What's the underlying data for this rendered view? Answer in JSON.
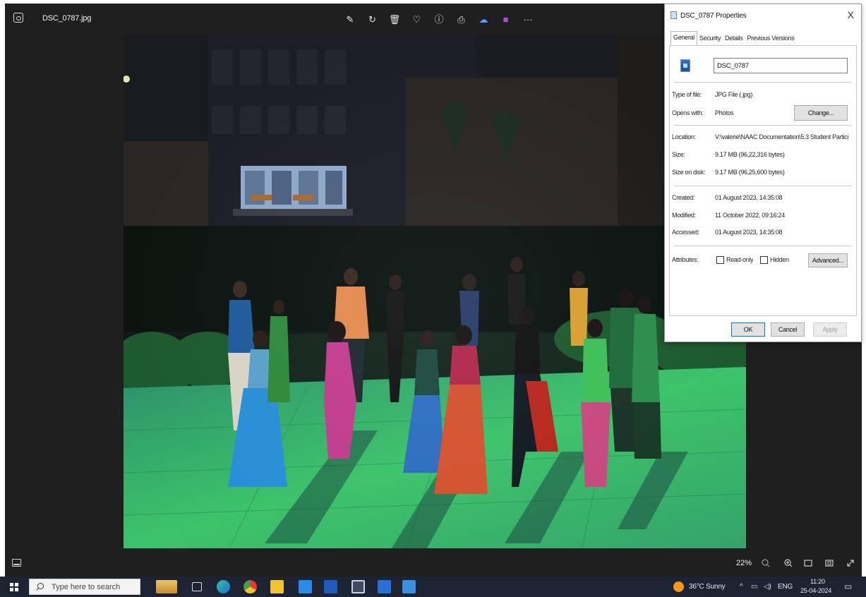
{
  "viewer": {
    "file_name": "DSC_0787.jpg",
    "toolbar": [
      {
        "icon": "edit-icon",
        "glyph": "✎"
      },
      {
        "icon": "rotate-icon",
        "glyph": "↻"
      },
      {
        "icon": "delete-icon",
        "glyph": "🗑"
      },
      {
        "icon": "favorite-icon",
        "glyph": "♡"
      },
      {
        "icon": "info-icon",
        "glyph": "ⓘ"
      },
      {
        "icon": "print-icon",
        "glyph": "⎙"
      },
      {
        "icon": "onedrive-icon",
        "glyph": "☁"
      },
      {
        "icon": "clipchamp-icon",
        "glyph": "■"
      },
      {
        "icon": "more-options-icon",
        "glyph": "···"
      }
    ],
    "zoom": "22%"
  },
  "dialog": {
    "title": "DSC_0787 Properties",
    "close_label": "X",
    "tabs": [
      "General",
      "Security",
      "Details",
      "Previous Versions"
    ],
    "file_name": "DSC_0787",
    "type_of_file_label": "Type of file:",
    "type_of_file": "JPG File (.jpg)",
    "opens_with_label": "Opens with:",
    "opens_with": "Photos",
    "change_label": "Change...",
    "location_label": "Location:",
    "location": "V:\\valerie\\NAAC Documentation\\5.3 Student Partici",
    "size_label": "Size:",
    "size": "9.17 MB (96,22,316 bytes)",
    "size_on_disk_label": "Size on disk:",
    "size_on_disk": "9.17 MB (96,25,600 bytes)",
    "created_label": "Created:",
    "created": "01 August 2023, 14:35:08",
    "modified_label": "Modified:",
    "modified": "11 October 2022, 09:16:24",
    "accessed_label": "Accessed:",
    "accessed": "01 August 2023, 14:35:08",
    "attributes_label": "Attributes:",
    "read_only_label": "Read-only",
    "hidden_label": "Hidden",
    "advanced_label": "Advanced...",
    "ok_label": "OK",
    "cancel_label": "Cancel",
    "apply_label": "Apply"
  },
  "taskbar": {
    "search_placeholder": "Type here to search",
    "weather": "36°C  Sunny",
    "language": "ENG",
    "time": "11:20",
    "date": "25-04-2024"
  },
  "colors": {
    "viewer_bg": "#1f1f1f",
    "taskbar_bg": "#1c2333",
    "photo_green": "#2fd36a"
  }
}
